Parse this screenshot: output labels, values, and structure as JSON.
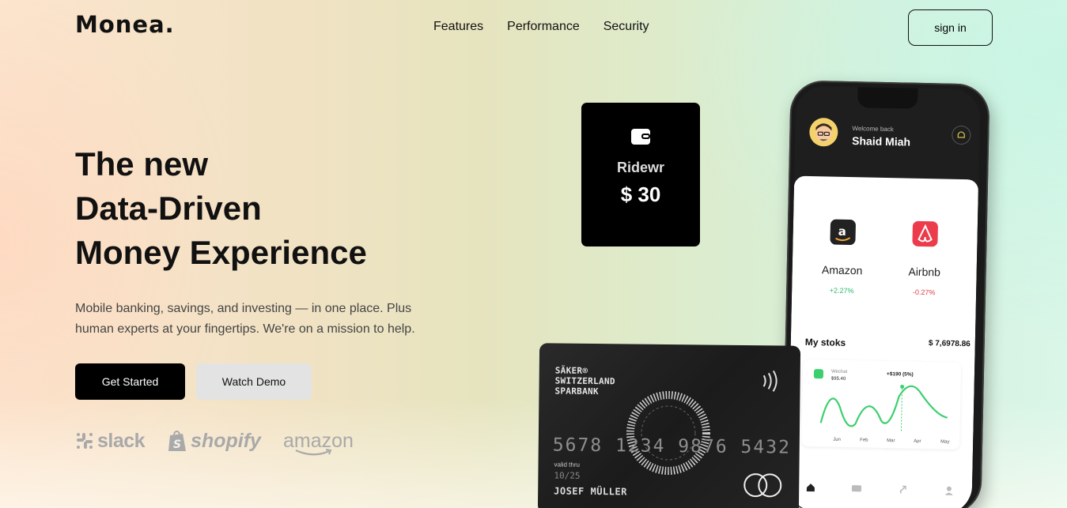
{
  "brand": {
    "logo": "Monea."
  },
  "nav": {
    "items": [
      "Features",
      "Performance",
      "Security"
    ],
    "sign_in": "sign in"
  },
  "hero": {
    "title_lines": [
      "The new",
      "Data-Driven",
      "Money Experience"
    ],
    "subtitle": "Mobile banking, savings, and investing — in one place. Plus human experts at your fingertips. We're on a mission to help.",
    "primary_button": "Get Started",
    "secondary_button": "Watch Demo"
  },
  "partners": [
    "slack",
    "shopify",
    "amazon"
  ],
  "ride_card": {
    "name": "Ridewr",
    "amount": "$ 30",
    "icon": "wallet-icon"
  },
  "phone": {
    "welcome": "Welcome back",
    "user": "Shaid Miah",
    "services": [
      {
        "name": "Amazon",
        "change": "+2.27%",
        "change_color": "#2fb86b",
        "bg": "#fdf0e8",
        "icon": "amazon-icon"
      },
      {
        "name": "Airbnb",
        "change": "-0.27%",
        "change_color": "#e2404b",
        "bg": "#fde9ec",
        "icon": "airbnb-icon"
      }
    ],
    "stocks_title": "My stoks",
    "stocks_total": "$ 7,6978.86",
    "chart": {
      "tooltip_left_name": "Wechat",
      "tooltip_left_value": "$95.40",
      "tooltip_right": "+$190 (5%)",
      "months": [
        "Jun",
        "Feb",
        "Mar",
        "Apr",
        "May"
      ],
      "line_color": "#3ccf6e"
    }
  },
  "bank_card": {
    "bank_name": "SÄKER®\nSWITZERLAND\nSPARBANK",
    "number": "5678 1234 9876 5432",
    "valid_label": "valid thru",
    "expiry": "10/25",
    "holder": "JOSEF MÜLLER"
  }
}
